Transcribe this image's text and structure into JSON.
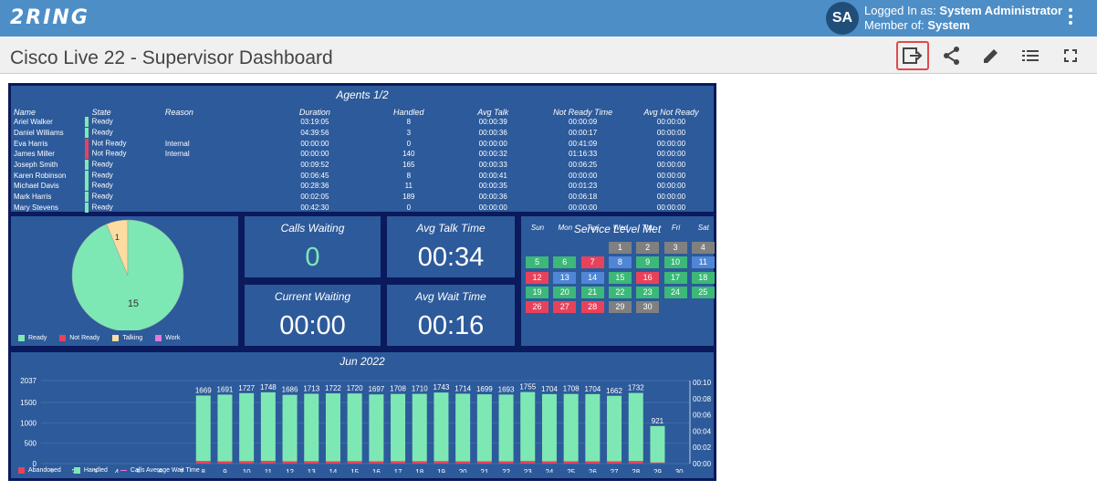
{
  "brand": {
    "logo_text": "2RING",
    "color": "#4e8ec7"
  },
  "user": {
    "initials": "SA",
    "logged_in_label": "Logged In as:",
    "name": "System Administrator",
    "member_label": "Member of:",
    "group": "System"
  },
  "page": {
    "title": "Cisco Live 22 - Supervisor Dashboard"
  },
  "toolbar": [
    {
      "name": "export-icon",
      "selected": true
    },
    {
      "name": "share-icon",
      "selected": false
    },
    {
      "name": "edit-icon",
      "selected": false
    },
    {
      "name": "list-icon",
      "selected": false
    },
    {
      "name": "fullscreen-icon",
      "selected": false
    }
  ],
  "agents": {
    "title": "Agents 1/2",
    "columns": [
      "Name",
      "State",
      "Reason",
      "Duration",
      "Handled",
      "Avg Talk",
      "Not Ready Time",
      "Avg Not Ready"
    ],
    "rows": [
      [
        "Ariel Walker",
        "Ready",
        "",
        "03:19:05",
        "8",
        "00:00:39",
        "00:00:09",
        "00:00:00"
      ],
      [
        "Daniel Williams",
        "Ready",
        "",
        "04:39:56",
        "3",
        "00:00:36",
        "00:00:17",
        "00:00:00"
      ],
      [
        "Eva Harris",
        "Not Ready",
        "Internal",
        "00:00:00",
        "0",
        "00:00:00",
        "00:41:09",
        "00:00:00"
      ],
      [
        "James Miller",
        "Not Ready",
        "Internal",
        "00:00:00",
        "140",
        "00:00:32",
        "01:16:33",
        "00:00:00"
      ],
      [
        "Joseph Smith",
        "Ready",
        "",
        "00:09:52",
        "165",
        "00:00:33",
        "00:06:25",
        "00:00:00"
      ],
      [
        "Karen Robinson",
        "Ready",
        "",
        "00:06:45",
        "8",
        "00:00:41",
        "00:00:00",
        "00:00:00"
      ],
      [
        "Michael Davis",
        "Ready",
        "",
        "00:28:36",
        "11",
        "00:00:35",
        "00:01:23",
        "00:00:00"
      ],
      [
        "Mark Harris",
        "Ready",
        "",
        "00:02:05",
        "189",
        "00:00:36",
        "00:06:18",
        "00:00:00"
      ],
      [
        "Mary Stevens",
        "Ready",
        "",
        "00:42:30",
        "0",
        "00:00:00",
        "00:00:00",
        "00:00:00"
      ]
    ],
    "state_colors": {
      "Ready": "#7ee8b5",
      "Not Ready": "#e8425a"
    }
  },
  "pie": {
    "slices": [
      {
        "label": "Ready",
        "value": 15,
        "color": "#7ee8b5"
      },
      {
        "label": "Talking",
        "value": 1,
        "color": "#fcdca0"
      }
    ],
    "legend": [
      {
        "label": "Ready",
        "color": "#7ee8b5"
      },
      {
        "label": "Not Ready",
        "color": "#e8425a"
      },
      {
        "label": "Talking",
        "color": "#fcdca0"
      },
      {
        "label": "Work",
        "color": "#e07ad8"
      }
    ]
  },
  "stats": [
    {
      "title": "Calls Waiting",
      "value": "0",
      "color": "#7ee8b5"
    },
    {
      "title": "Avg Talk Time",
      "value": "00:34",
      "color": "#ffffff"
    },
    {
      "title": "Current Waiting",
      "value": "00:00",
      "color": "#ffffff"
    },
    {
      "title": "Avg Wait Time",
      "value": "00:16",
      "color": "#ffffff"
    }
  ],
  "calendar": {
    "title": "Service Level Met",
    "dow": [
      "Sun",
      "Mon",
      "Tue",
      "Wed",
      "Thu",
      "Fri",
      "Sat"
    ],
    "first_weekday": 3,
    "days": [
      {
        "d": "1",
        "c": "#808080"
      },
      {
        "d": "2",
        "c": "#808080"
      },
      {
        "d": "3",
        "c": "#808080"
      },
      {
        "d": "4",
        "c": "#808080"
      },
      {
        "d": "5",
        "c": "#3cb878"
      },
      {
        "d": "6",
        "c": "#3cb878"
      },
      {
        "d": "7",
        "c": "#e8425a"
      },
      {
        "d": "8",
        "c": "#4f86d6"
      },
      {
        "d": "9",
        "c": "#3cb878"
      },
      {
        "d": "10",
        "c": "#3cb878"
      },
      {
        "d": "11",
        "c": "#4f86d6"
      },
      {
        "d": "12",
        "c": "#e8425a"
      },
      {
        "d": "13",
        "c": "#4f86d6"
      },
      {
        "d": "14",
        "c": "#4f86d6"
      },
      {
        "d": "15",
        "c": "#3cb878"
      },
      {
        "d": "16",
        "c": "#e8425a"
      },
      {
        "d": "17",
        "c": "#3cb878"
      },
      {
        "d": "18",
        "c": "#3cb878"
      },
      {
        "d": "19",
        "c": "#3cb878"
      },
      {
        "d": "20",
        "c": "#3cb878"
      },
      {
        "d": "21",
        "c": "#3cb878"
      },
      {
        "d": "22",
        "c": "#3cb878"
      },
      {
        "d": "23",
        "c": "#3cb878"
      },
      {
        "d": "24",
        "c": "#3cb878"
      },
      {
        "d": "25",
        "c": "#3cb878"
      },
      {
        "d": "26",
        "c": "#e8425a"
      },
      {
        "d": "27",
        "c": "#e8425a"
      },
      {
        "d": "28",
        "c": "#e8425a"
      },
      {
        "d": "29",
        "c": "#808080"
      },
      {
        "d": "30",
        "c": "#808080"
      }
    ]
  },
  "chart_data": {
    "type": "bar",
    "title": "Jun 2022",
    "categories": [
      "1",
      "2",
      "3",
      "4",
      "5",
      "6",
      "7",
      "8",
      "9",
      "10",
      "11",
      "12",
      "13",
      "14",
      "15",
      "16",
      "17",
      "18",
      "19",
      "20",
      "21",
      "22",
      "23",
      "24",
      "25",
      "26",
      "27",
      "28",
      "29",
      "30"
    ],
    "series": [
      {
        "name": "Abandoned",
        "color": "#e8425a",
        "values": [
          0,
          0,
          0,
          0,
          0,
          0,
          0,
          60,
          55,
          58,
          62,
          55,
          57,
          56,
          58,
          56,
          57,
          57,
          58,
          56,
          55,
          55,
          60,
          54,
          55,
          55,
          54,
          60,
          25,
          0
        ]
      },
      {
        "name": "Handled",
        "color": "#7ee8b5",
        "values": [
          0,
          0,
          0,
          0,
          0,
          0,
          0,
          1609,
          1636,
          1669,
          1686,
          1631,
          1656,
          1666,
          1662,
          1641,
          1651,
          1653,
          1685,
          1658,
          1644,
          1638,
          1695,
          1650,
          1653,
          1649,
          1608,
          1672,
          896,
          0
        ]
      },
      {
        "name": "Calls Average Wait Time",
        "color": "#e07ad8",
        "values": []
      }
    ],
    "totals": [
      "",
      "",
      "",
      "",
      "",
      "",
      "",
      "1669",
      "1691",
      "1727",
      "1748",
      "1686",
      "1713",
      "1722",
      "1720",
      "1697",
      "1708",
      "1710",
      "1743",
      "1714",
      "1699",
      "1693",
      "1755",
      "1704",
      "1708",
      "1704",
      "1662",
      "1732",
      "921",
      ""
    ],
    "y_ticks": [
      "0",
      "500",
      "1000",
      "1500",
      "2037"
    ],
    "y_tick_values": [
      0,
      500,
      1000,
      1500,
      2037
    ],
    "y2_ticks": [
      "00:00",
      "00:02",
      "00:04",
      "00:06",
      "00:08",
      "00:10"
    ],
    "ylim": [
      0,
      2037
    ],
    "grid": true
  }
}
